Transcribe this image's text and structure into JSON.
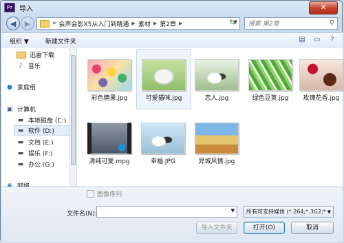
{
  "window": {
    "title": "导入",
    "app_icon": "Pr",
    "close_label": "✕"
  },
  "nav": {
    "back_label": "◀",
    "forward_label": "▶",
    "breadcrumb": [
      "«",
      "会声会影X5从入门到精通",
      "素材",
      "第2章"
    ],
    "refresh_label": "⇆",
    "search_placeholder": "搜索 第2章"
  },
  "toolbar": {
    "organize": "组织 ▼",
    "new_folder": "新建文件夹"
  },
  "sidebar": {
    "items": [
      {
        "label": "迅雷下载",
        "icon": "download-folder-icon"
      },
      {
        "label": "音乐",
        "icon": "music-icon"
      },
      {
        "label": "家庭组",
        "icon": "homegroup-icon"
      },
      {
        "label": "计算机",
        "icon": "computer-icon"
      },
      {
        "label": "本地磁盘 (C:)",
        "icon": "drive-icon"
      },
      {
        "label": "软件 (D:)",
        "icon": "drive-icon"
      },
      {
        "label": "文档 (E:)",
        "icon": "drive-icon"
      },
      {
        "label": "娱乐 (F:)",
        "icon": "drive-icon"
      },
      {
        "label": "办公 (G:)",
        "icon": "drive-icon"
      },
      {
        "label": "网络",
        "icon": "network-icon"
      }
    ]
  },
  "files": [
    {
      "name": "彩色糖果.jpg"
    },
    {
      "name": "可爱猫咪.jpg"
    },
    {
      "name": "恋人.jpg"
    },
    {
      "name": "绿色豆荚.jpg"
    },
    {
      "name": "玫瑰花香.jpg"
    },
    {
      "name": "清纯可爱.mpg"
    },
    {
      "name": "幸福.JPG"
    },
    {
      "name": "异城风情.jpg"
    }
  ],
  "bottom": {
    "image_sequence_label": "图像序列",
    "filename_label": "文件名(N):",
    "filename_value": "",
    "filter_value": "所有可支持媒体 (*.264;*.3G2;*",
    "import_folder_label": "导入文件夹",
    "open_label": "打开(O)",
    "cancel_label": "取消"
  }
}
